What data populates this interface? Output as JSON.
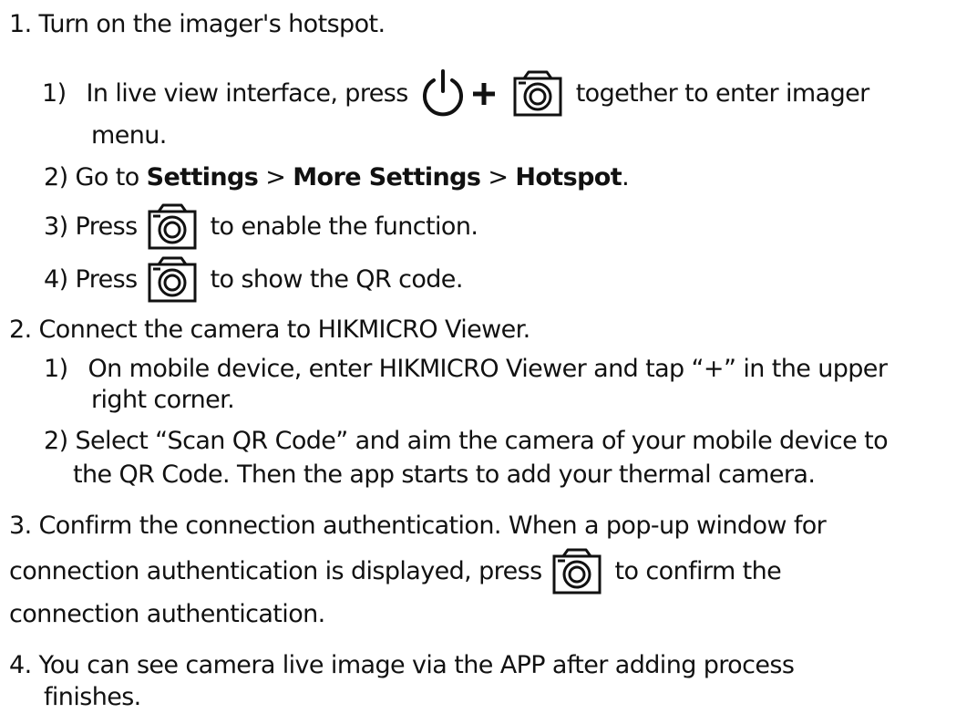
{
  "steps": {
    "s1": {
      "title": "1. Turn on the imager's hotspot.",
      "sub1": {
        "num": "1)",
        "text_a": "In live view interface, press",
        "text_b": "together to enter imager",
        "cont": "menu."
      },
      "sub2": {
        "text_a": "2) Go to ",
        "settings": "Settings",
        "sep1": " > ",
        "more": "More Settings",
        "sep2": " > ",
        "hotspot": "Hotspot",
        "end": "."
      },
      "sub3": {
        "text_a": "3) Press",
        "text_b": "to enable the function."
      },
      "sub4": {
        "text_a": "4) Press",
        "text_b": "to show the QR code."
      }
    },
    "s2": {
      "title": "2. Connect the camera to HIKMICRO Viewer.",
      "sub1": {
        "num": "1)",
        "line1": "On mobile device, enter HIKMICRO Viewer and tap “+” in the upper",
        "line2": "right corner."
      },
      "sub2": {
        "line1": "2) Select “Scan QR Code” and aim the camera of your mobile device to",
        "line2": "the QR Code. Then the app starts to add your thermal camera."
      }
    },
    "s3": {
      "line1": "3. Confirm the connection authentication. When a pop-up window for",
      "line2a": "connection authentication is displayed, press",
      "line2b": "to confirm the",
      "line3": "connection authentication."
    },
    "s4": {
      "line1": "4. You can see camera live image via the APP after adding process",
      "line2": "finishes."
    }
  },
  "icons": {
    "capture": "camera-icon",
    "power": "power-icon",
    "plus": "plus-icon"
  },
  "colors": {
    "text": "#111111",
    "background": "#ffffff"
  }
}
